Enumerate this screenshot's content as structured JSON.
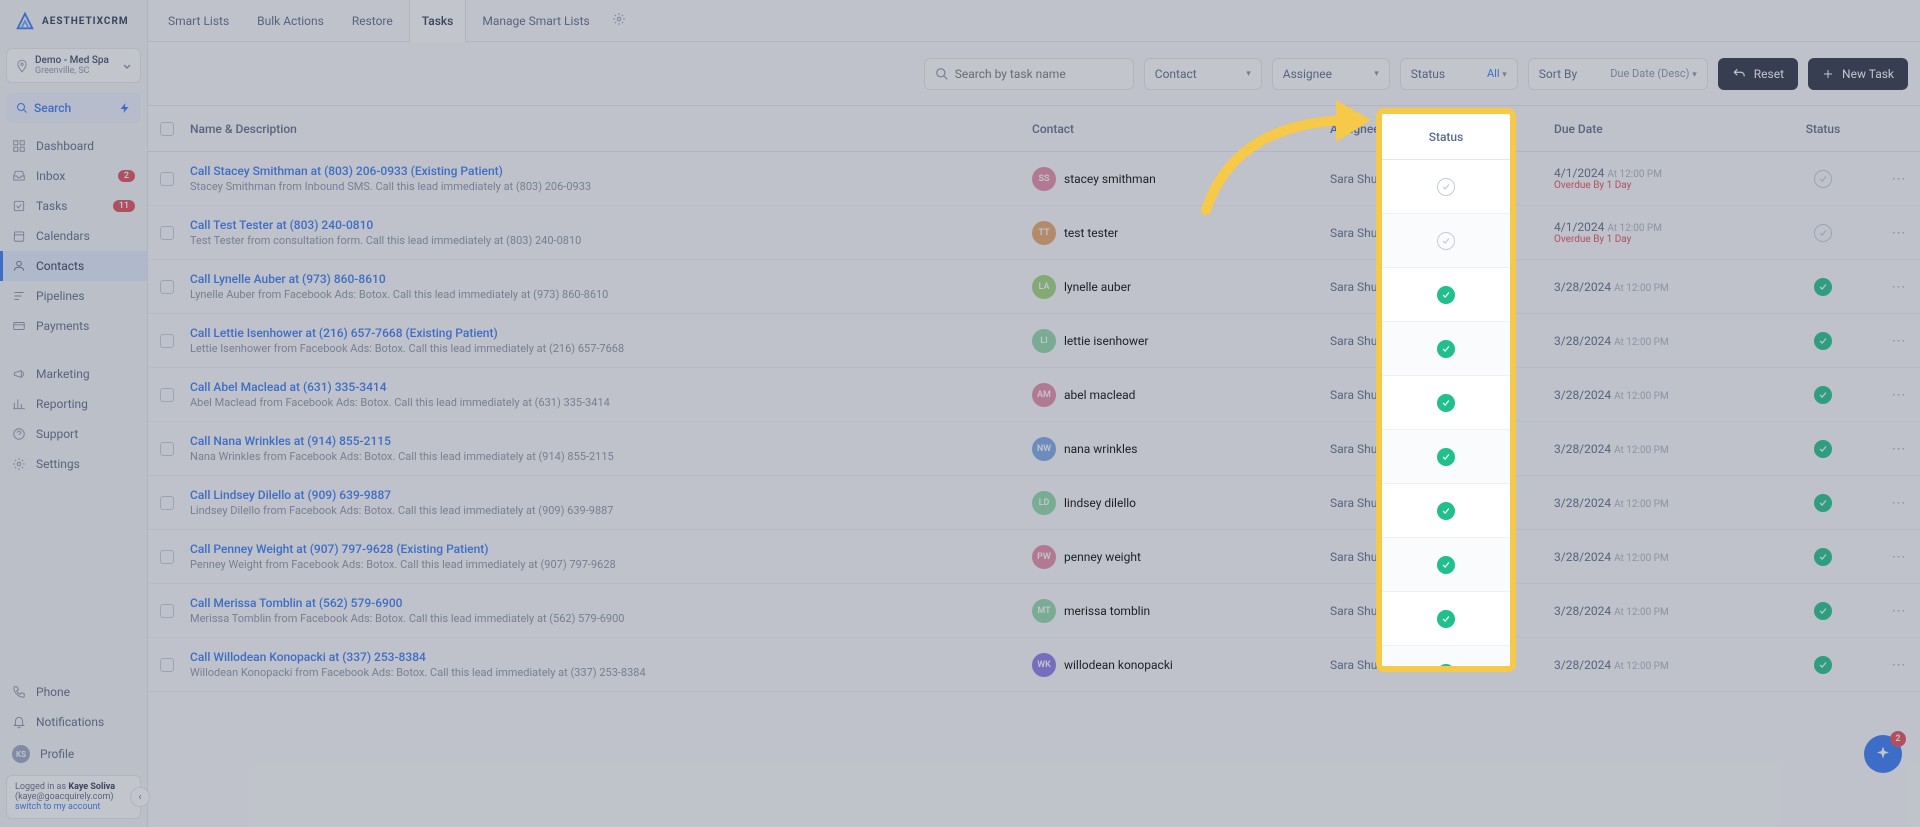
{
  "brand": {
    "name": "AESTHETIXCRM"
  },
  "location": {
    "name": "Demo - Med Spa",
    "sub": "Greenville, SC"
  },
  "sidebar": {
    "search_label": "Search",
    "items": [
      {
        "label": "Dashboard",
        "icon": "dashboard"
      },
      {
        "label": "Inbox",
        "icon": "inbox",
        "badge": "2"
      },
      {
        "label": "Tasks",
        "icon": "tasks",
        "badge": "11"
      },
      {
        "label": "Calendars",
        "icon": "calendar"
      },
      {
        "label": "Contacts",
        "icon": "contacts",
        "active": true
      },
      {
        "label": "Pipelines",
        "icon": "pipeline"
      },
      {
        "label": "Payments",
        "icon": "payments"
      }
    ],
    "items2": [
      {
        "label": "Marketing",
        "icon": "marketing"
      },
      {
        "label": "Reporting",
        "icon": "reporting"
      },
      {
        "label": "Support",
        "icon": "support"
      },
      {
        "label": "Settings",
        "icon": "settings"
      }
    ],
    "bottom": [
      {
        "label": "Phone",
        "icon": "phone"
      },
      {
        "label": "Notifications",
        "icon": "bell"
      },
      {
        "label": "Profile",
        "avatar": "KS"
      }
    ],
    "impersonate": {
      "prefix": "Logged in as ",
      "name": "Kaye Soliva",
      "email": "(kaye@goacquirely.com)",
      "switch": "switch to my account"
    }
  },
  "topnav": {
    "tabs": [
      "Smart Lists",
      "Bulk Actions",
      "Restore",
      "Tasks",
      "Manage Smart Lists"
    ],
    "active_index": 3
  },
  "toolbar": {
    "search_placeholder": "Search by task name",
    "contact_label": "Contact",
    "assignee_label": "Assignee",
    "status_label": "Status",
    "status_value": "All",
    "sort_label": "Sort By",
    "sort_value": "Due Date (Desc)",
    "reset_label": "Reset",
    "new_task_label": "New Task"
  },
  "columns": {
    "name": "Name & Description",
    "contact": "Contact",
    "assignee": "Assignee",
    "due": "Due Date",
    "status": "Status"
  },
  "tasks": [
    {
      "title": "Call Stacey Smithman at (803) 206-0933 (Existing Patient)",
      "desc": "Stacey Smithman from Inbound SMS. Call this lead immediately at (803) 206-0933",
      "contact": "stacey smithman",
      "initials": "SS",
      "color": "#e78aa6",
      "assignee": "Sara Shumpert",
      "date": "4/1/2024",
      "time": "At 12:00 PM",
      "overdue": "Overdue By 1 Day",
      "status": "open"
    },
    {
      "title": "Call Test Tester at (803) 240-0810",
      "desc": "Test Tester from consultation form. Call this lead immediately at (803) 240-0810",
      "contact": "test tester",
      "initials": "TT",
      "color": "#e9a66a",
      "assignee": "Sara Shumpert",
      "date": "4/1/2024",
      "time": "At 12:00 PM",
      "overdue": "Overdue By 1 Day",
      "status": "open"
    },
    {
      "title": "Call Lynelle Auber at (973) 860-8610",
      "desc": "Lynelle Auber from Facebook Ads: Botox. Call this lead immediately at (973) 860-8610",
      "contact": "lynelle auber",
      "initials": "LA",
      "color": "#9fd67a",
      "assignee": "Sara Shumpert",
      "date": "3/28/2024",
      "time": "At 12:00 PM",
      "status": "done"
    },
    {
      "title": "Call Lettie Isenhower at (216) 657-7668 (Existing Patient)",
      "desc": "Lettie Isenhower from Facebook Ads: Botox. Call this lead immediately at (216) 657-7668",
      "contact": "lettie isenhower",
      "initials": "LI",
      "color": "#8fd9a8",
      "assignee": "Sara Shumpert",
      "date": "3/28/2024",
      "time": "At 12:00 PM",
      "status": "done"
    },
    {
      "title": "Call Abel Maclead at (631) 335-3414",
      "desc": "Abel Maclead from Facebook Ads: Botox. Call this lead immediately at (631) 335-3414",
      "contact": "abel maclead",
      "initials": "AM",
      "color": "#e78aa6",
      "assignee": "Sara Shumpert",
      "date": "3/28/2024",
      "time": "At 12:00 PM",
      "status": "done"
    },
    {
      "title": "Call Nana Wrinkles at (914) 855-2115",
      "desc": "Nana Wrinkles from Facebook Ads: Botox. Call this lead immediately at (914) 855-2115",
      "contact": "nana wrinkles",
      "initials": "NW",
      "color": "#7aa8e8",
      "assignee": "Sara Shumpert",
      "date": "3/28/2024",
      "time": "At 12:00 PM",
      "status": "done"
    },
    {
      "title": "Call Lindsey Dilello at (909) 639-9887",
      "desc": "Lindsey Dilello from Facebook Ads: Botox. Call this lead immediately at (909) 639-9887",
      "contact": "lindsey dilello",
      "initials": "LD",
      "color": "#8fd9a8",
      "assignee": "Sara Shumpert",
      "date": "3/28/2024",
      "time": "At 12:00 PM",
      "status": "done"
    },
    {
      "title": "Call Penney Weight at (907) 797-9628 (Existing Patient)",
      "desc": "Penney Weight from Facebook Ads: Botox. Call this lead immediately at (907) 797-9628",
      "contact": "penney weight",
      "initials": "PW",
      "color": "#e78aa6",
      "assignee": "Sara Shumpert",
      "date": "3/28/2024",
      "time": "At 12:00 PM",
      "status": "done"
    },
    {
      "title": "Call Merissa Tomblin at (562) 579-6900",
      "desc": "Merissa Tomblin from Facebook Ads: Botox. Call this lead immediately at (562) 579-6900",
      "contact": "merissa tomblin",
      "initials": "MT",
      "color": "#8fd9a8",
      "assignee": "Sara Shumpert",
      "date": "3/28/2024",
      "time": "At 12:00 PM",
      "status": "done"
    },
    {
      "title": "Call Willodean Konopacki at (337) 253-8384",
      "desc": "Willodean Konopacki from Facebook Ads: Botox. Call this lead immediately at (337) 253-8384",
      "contact": "willodean konopacki",
      "initials": "WK",
      "color": "#8a7ae8",
      "assignee": "Sara Shumpert",
      "date": "3/28/2024",
      "time": "At 12:00 PM",
      "status": "done"
    }
  ],
  "fab_badge": "2"
}
